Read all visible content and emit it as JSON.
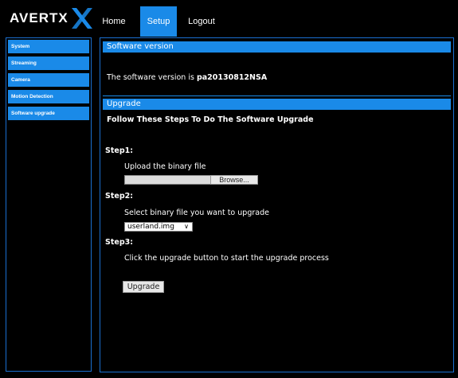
{
  "app": {
    "logo_text": "AVERTX"
  },
  "nav": {
    "home": "Home",
    "setup": "Setup",
    "logout": "Logout"
  },
  "sidebar": {
    "items": [
      {
        "label": "System"
      },
      {
        "label": "Streaming"
      },
      {
        "label": "Camera"
      },
      {
        "label": "Motion Detection"
      },
      {
        "label": "Software upgrade"
      }
    ]
  },
  "software_version": {
    "title": "Software version",
    "prefix": "The software version is",
    "version": "pa20130812NSA"
  },
  "upgrade": {
    "title": "Upgrade",
    "heading": "Follow These Steps To Do The Software Upgrade",
    "step1_label": "Step1:",
    "step1_text": "Upload the binary file",
    "browse_label": "Browse...",
    "file_value": "",
    "step2_label": "Step2:",
    "step2_text": "Select binary file you want to upgrade",
    "select_value": "userland.img",
    "step3_label": "Step3:",
    "step3_text": "Click the upgrade button to start the upgrade process",
    "upgrade_button": "Upgrade"
  },
  "colors": {
    "accent": "#1a8ae8",
    "background": "#000000"
  }
}
